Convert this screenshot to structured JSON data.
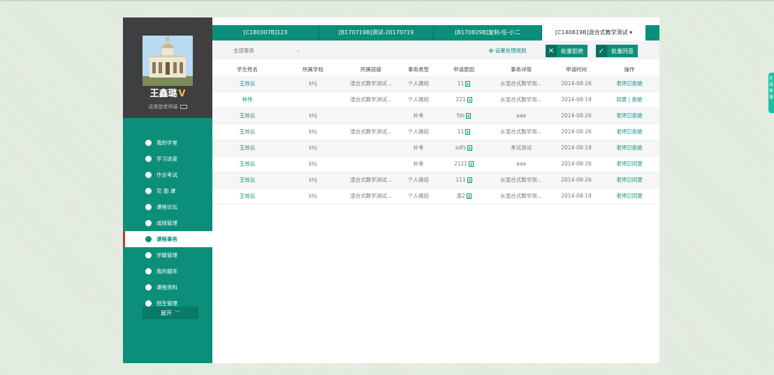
{
  "user": {
    "name": "王鑫璐",
    "vip": "V",
    "subtitle": "这里是老师端"
  },
  "menu": [
    {
      "label": "我的学堂",
      "icon": "home-icon"
    },
    {
      "label": "学习进度",
      "icon": "progress-icon"
    },
    {
      "label": "作业考试",
      "icon": "pencil-icon"
    },
    {
      "label": "见 面 课",
      "icon": "meeting-icon"
    },
    {
      "label": "课程论坛",
      "icon": "forum-icon"
    },
    {
      "label": "成绩管理",
      "icon": "check-icon"
    },
    {
      "label": "课程事务",
      "icon": "affairs-icon",
      "active": true
    },
    {
      "label": "学籍管理",
      "icon": "roster-icon"
    },
    {
      "label": "我的题库",
      "icon": "question-bank-icon"
    },
    {
      "label": "课程资料",
      "icon": "materials-icon"
    },
    {
      "label": "招生管理",
      "icon": "enrollment-icon"
    }
  ],
  "expand_label": "展开",
  "tabs": [
    {
      "label": "[C180307B]123"
    },
    {
      "label": "[B170719B]测试-20170719"
    },
    {
      "label": "[B170829B]复制-任-小二"
    },
    {
      "label": "[C140819B]混合式教学测试 ▾",
      "active": true
    }
  ],
  "toolbar": {
    "filter": "全部事务",
    "rules_link": "设置处理规则",
    "reject_all": "批量拒绝",
    "approve_all": "批量同意"
  },
  "table": {
    "headers": [
      "学生姓名",
      "所属学校",
      "所属班级",
      "事务类型",
      "申请原因",
      "事务详情",
      "申请时间",
      "操作"
    ],
    "rows": [
      {
        "name": "王效云",
        "school": "khj",
        "class": "混合式教学测试...",
        "type": "个人换班",
        "reason": "11",
        "detail": "从混合式教学测...",
        "date": "2014-08-26",
        "op": "老师已拒绝"
      },
      {
        "name": "林伟",
        "school": "",
        "class": "混合式教学测试...",
        "type": "个人换班",
        "reason": "221",
        "detail": "从混合式教学测...",
        "date": "2014-08-19",
        "op_agree": "同意",
        "op_sep": " | ",
        "op_reject": "拒绝"
      },
      {
        "name": "王效云",
        "school": "khj",
        "class": "",
        "type": "补考",
        "reason": "fds",
        "detail": "aaa",
        "date": "2014-08-26",
        "op": "老师已拒绝"
      },
      {
        "name": "王效云",
        "school": "khj",
        "class": "混合式教学测试...",
        "type": "个人换班",
        "reason": "11",
        "detail": "从混合式教学测...",
        "date": "2014-08-26",
        "op": "老师已拒绝"
      },
      {
        "name": "王效云",
        "school": "khj",
        "class": "",
        "type": "补考",
        "reason": "sdfs",
        "detail": "考试测试",
        "date": "2014-08-19",
        "op": "老师已拒绝"
      },
      {
        "name": "王效云",
        "school": "khj",
        "class": "",
        "type": "补考",
        "reason": "2121",
        "detail": "aaa",
        "date": "2014-08-26",
        "op": "老师已同意"
      },
      {
        "name": "王效云",
        "school": "khj",
        "class": "混合式教学测试...",
        "type": "个人换班",
        "reason": "111",
        "detail": "从混合式教学测...",
        "date": "2014-08-26",
        "op": "老师已同意"
      },
      {
        "name": "王效云",
        "school": "khj",
        "class": "混合式教学测试...",
        "type": "个人换班",
        "reason": "混2",
        "detail": "从混合式教学测...",
        "date": "2014-08-19",
        "op": "老师已同意"
      }
    ]
  },
  "float_tab": "在线客服",
  "colors": {
    "primary": "#0c8f7a",
    "sidebar_dark": "#3f3f3f",
    "accent_active": "#c0392b"
  }
}
